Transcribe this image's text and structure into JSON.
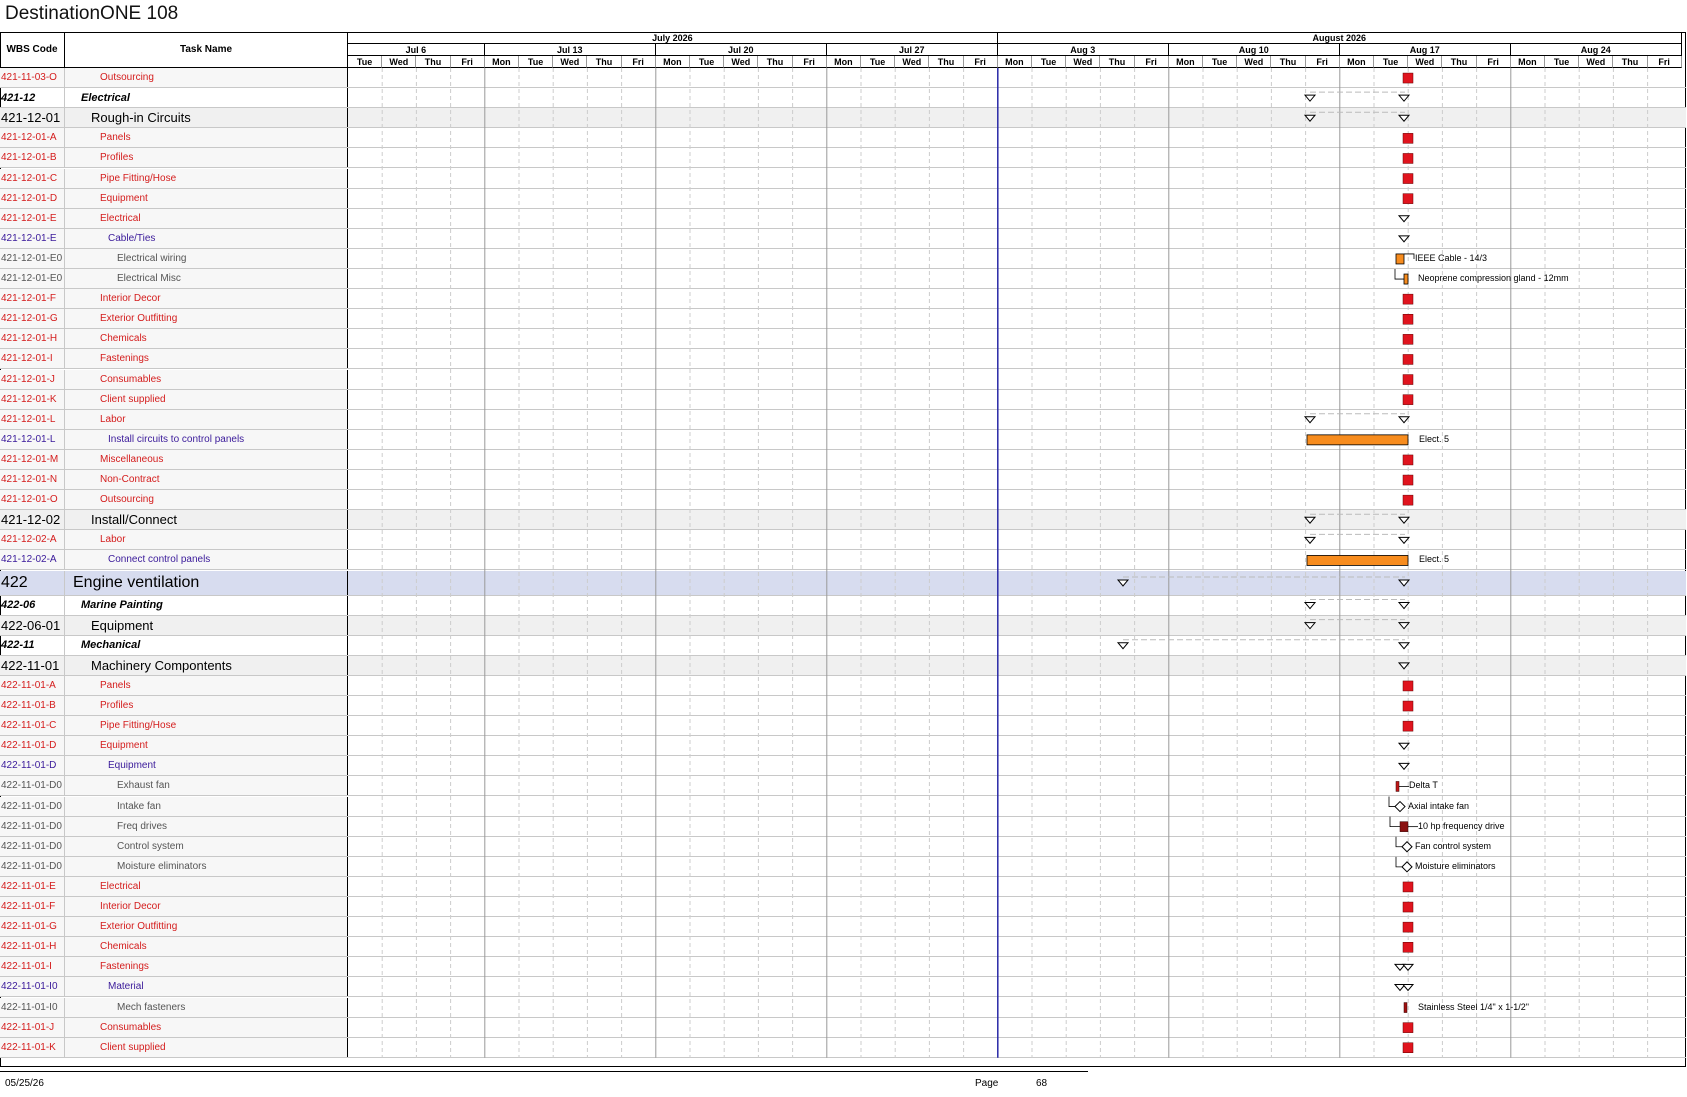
{
  "title": "DestinationONE 108",
  "headers": {
    "wbs": "WBS Code",
    "task": "Task Name"
  },
  "months": [
    "July 2026",
    "August 2026"
  ],
  "weeks": [
    "Jul 6",
    "Jul 13",
    "Jul 20",
    "Jul 27",
    "Aug 3",
    "Aug 10",
    "Aug 17",
    "Aug 24"
  ],
  "days": [
    "Tue",
    "Wed",
    "Thu",
    "Fri",
    "Mon",
    "Tue",
    "Wed",
    "Thu",
    "Fri",
    "Mon",
    "Tue",
    "Wed",
    "Thu",
    "Fri",
    "Mon",
    "Tue",
    "Wed",
    "Thu",
    "Fri",
    "Mon",
    "Tue",
    "Wed",
    "Thu",
    "Fri",
    "Mon",
    "Tue",
    "Wed",
    "Thu",
    "Fri",
    "Mon",
    "Tue",
    "Wed",
    "Thu",
    "Fri",
    "Mon",
    "Tue",
    "Wed",
    "Thu",
    "Fri"
  ],
  "rows": [
    {
      "wbs": "421-11-03-O",
      "task": "Outsourcing",
      "style": "red",
      "indent": 3,
      "mark": "sq"
    },
    {
      "wbs": "421-12",
      "task": "Electrical",
      "style": "ital",
      "indent": 1,
      "mark": "sum"
    },
    {
      "wbs": "421-12-01",
      "task": "Rough-in Circuits",
      "style": "sum",
      "indent": 2,
      "mark": "sum"
    },
    {
      "wbs": "421-12-01-A",
      "task": "Panels",
      "style": "red",
      "indent": 3,
      "mark": "sq"
    },
    {
      "wbs": "421-12-01-B",
      "task": "Profiles",
      "style": "red",
      "indent": 3,
      "mark": "sq"
    },
    {
      "wbs": "421-12-01-C",
      "task": "Pipe Fitting/Hose",
      "style": "red",
      "indent": 3,
      "mark": "sq"
    },
    {
      "wbs": "421-12-01-D",
      "task": "Equipment",
      "style": "red",
      "indent": 3,
      "mark": "sq"
    },
    {
      "wbs": "421-12-01-E",
      "task": "Electrical",
      "style": "red",
      "indent": 3,
      "mark": "tri"
    },
    {
      "wbs": "421-12-01-E",
      "task": "Cable/Ties",
      "style": "purple",
      "indent": 4,
      "mark": "tri"
    },
    {
      "wbs": "421-12-01-E0",
      "task": "Electrical wiring",
      "style": "gray",
      "indent": 5,
      "mark": "bar-small",
      "label": "IEEE Cable - 14/3"
    },
    {
      "wbs": "421-12-01-E0",
      "task": "Electrical Misc",
      "style": "gray",
      "indent": 5,
      "mark": "bar-tiny",
      "label": "Neoprene compression gland - 12mm"
    },
    {
      "wbs": "421-12-01-F",
      "task": "Interior Decor",
      "style": "red",
      "indent": 3,
      "mark": "sq"
    },
    {
      "wbs": "421-12-01-G",
      "task": "Exterior Outfitting",
      "style": "red",
      "indent": 3,
      "mark": "sq"
    },
    {
      "wbs": "421-12-01-H",
      "task": "Chemicals",
      "style": "red",
      "indent": 3,
      "mark": "sq"
    },
    {
      "wbs": "421-12-01-I",
      "task": "Fastenings",
      "style": "red",
      "indent": 3,
      "mark": "sq"
    },
    {
      "wbs": "421-12-01-J",
      "task": "Consumables",
      "style": "red",
      "indent": 3,
      "mark": "sq"
    },
    {
      "wbs": "421-12-01-K",
      "task": "Client supplied",
      "style": "red",
      "indent": 3,
      "mark": "sq"
    },
    {
      "wbs": "421-12-01-L",
      "task": "Labor",
      "style": "red",
      "indent": 3,
      "mark": "sum"
    },
    {
      "wbs": "421-12-01-L",
      "task": "Install circuits to control panels",
      "style": "purple",
      "indent": 4,
      "mark": "bar-long",
      "label": "Elect. 5"
    },
    {
      "wbs": "421-12-01-M",
      "task": "Miscellaneous",
      "style": "red",
      "indent": 3,
      "mark": "sq"
    },
    {
      "wbs": "421-12-01-N",
      "task": "Non-Contract",
      "style": "red",
      "indent": 3,
      "mark": "sq"
    },
    {
      "wbs": "421-12-01-O",
      "task": "Outsourcing",
      "style": "red",
      "indent": 3,
      "mark": "sq"
    },
    {
      "wbs": "421-12-02",
      "task": "Install/Connect",
      "style": "sum",
      "indent": 2,
      "mark": "sum"
    },
    {
      "wbs": "421-12-02-A",
      "task": "Labor",
      "style": "red",
      "indent": 3,
      "mark": "sum"
    },
    {
      "wbs": "421-12-02-A",
      "task": "Connect control panels",
      "style": "purple",
      "indent": 4,
      "mark": "bar-long",
      "label": "Elect. 5"
    },
    {
      "wbs": "422",
      "task": "Engine ventilation",
      "style": "big",
      "indent": 0,
      "mark": "sum-wide"
    },
    {
      "wbs": "422-06",
      "task": "Marine Painting",
      "style": "ital",
      "indent": 1,
      "mark": "sum"
    },
    {
      "wbs": "422-06-01",
      "task": "Equipment",
      "style": "sum",
      "indent": 2,
      "mark": "sum"
    },
    {
      "wbs": "422-11",
      "task": "Mechanical",
      "style": "ital",
      "indent": 1,
      "mark": "sum-wide"
    },
    {
      "wbs": "422-11-01",
      "task": "Machinery Compontents",
      "style": "sum",
      "indent": 2,
      "mark": "tri"
    },
    {
      "wbs": "422-11-01-A",
      "task": "Panels",
      "style": "red",
      "indent": 3,
      "mark": "sq"
    },
    {
      "wbs": "422-11-01-B",
      "task": "Profiles",
      "style": "red",
      "indent": 3,
      "mark": "sq"
    },
    {
      "wbs": "422-11-01-C",
      "task": "Pipe Fitting/Hose",
      "style": "red",
      "indent": 3,
      "mark": "sq"
    },
    {
      "wbs": "422-11-01-D",
      "task": "Equipment",
      "style": "red",
      "indent": 3,
      "mark": "tri"
    },
    {
      "wbs": "422-11-01-D",
      "task": "Equipment",
      "style": "purple",
      "indent": 4,
      "mark": "tri"
    },
    {
      "wbs": "422-11-01-D0",
      "task": "Exhaust fan",
      "style": "gray",
      "indent": 5,
      "mark": "bar-red-thin",
      "label": "Delta T"
    },
    {
      "wbs": "422-11-01-D0",
      "task": "Intake fan",
      "style": "gray",
      "indent": 5,
      "mark": "diamond-a",
      "label": "Axial intake fan"
    },
    {
      "wbs": "422-11-01-D0",
      "task": "Freq drives",
      "style": "gray",
      "indent": 5,
      "mark": "bar-darkred",
      "label": "10 hp frequency drive"
    },
    {
      "wbs": "422-11-01-D0",
      "task": "Control system",
      "style": "gray",
      "indent": 5,
      "mark": "diamond-b",
      "label": "Fan control system"
    },
    {
      "wbs": "422-11-01-D0",
      "task": "Moisture eliminators",
      "style": "gray",
      "indent": 5,
      "mark": "diamond-b",
      "label": "Moisture eliminators"
    },
    {
      "wbs": "422-11-01-E",
      "task": "Electrical",
      "style": "red",
      "indent": 3,
      "mark": "sq"
    },
    {
      "wbs": "422-11-01-F",
      "task": "Interior Decor",
      "style": "red",
      "indent": 3,
      "mark": "sq"
    },
    {
      "wbs": "422-11-01-G",
      "task": "Exterior Outfitting",
      "style": "red",
      "indent": 3,
      "mark": "sq"
    },
    {
      "wbs": "422-11-01-H",
      "task": "Chemicals",
      "style": "red",
      "indent": 3,
      "mark": "sq"
    },
    {
      "wbs": "422-11-01-I",
      "task": "Fastenings",
      "style": "red",
      "indent": 3,
      "mark": "tri2"
    },
    {
      "wbs": "422-11-01-I0",
      "task": "Material",
      "style": "purple",
      "indent": 4,
      "mark": "tri2"
    },
    {
      "wbs": "422-11-01-I0",
      "task": "Mech fasteners",
      "style": "gray",
      "indent": 5,
      "mark": "bar-line",
      "label": "Stainless Steel 1/4\" x 1-1/2\""
    },
    {
      "wbs": "422-11-01-J",
      "task": "Consumables",
      "style": "red",
      "indent": 3,
      "mark": "sq"
    },
    {
      "wbs": "422-11-01-K",
      "task": "Client supplied",
      "style": "red",
      "indent": 3,
      "mark": "sq"
    }
  ],
  "footer": {
    "date": "05/25/26",
    "page_label": "Page",
    "page_number": "68"
  },
  "colors": {
    "task_red": "#d41c1c",
    "task_purple": "#3a1a9a",
    "bar_orange": "#f78c1e",
    "milestone_red": "#e0141e",
    "status_line": "#2a2aa8"
  }
}
